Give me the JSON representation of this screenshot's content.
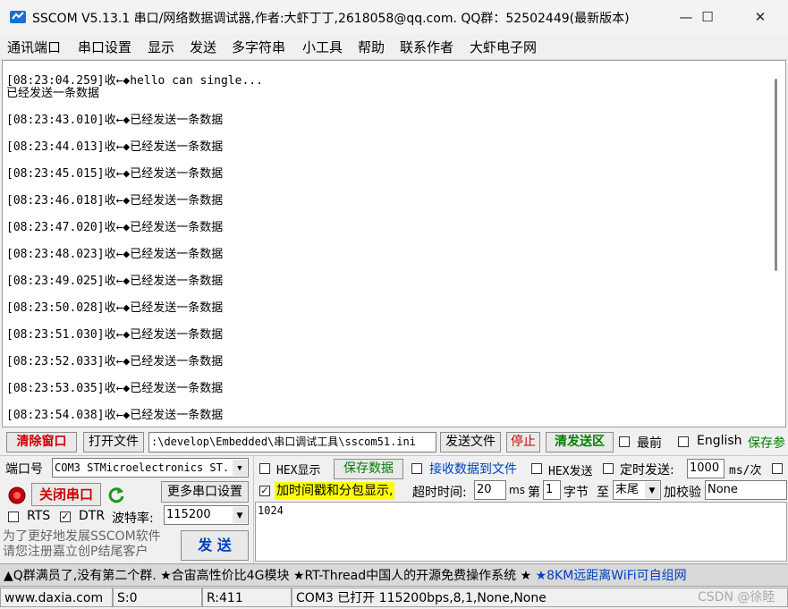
{
  "window": {
    "title": "SSCOM V5.13.1 串口/网络数据调试器,作者:大虾丁丁,2618058@qq.com. QQ群：52502449(最新版本)",
    "minimize": "—",
    "maximize": "☐",
    "close": "✕"
  },
  "menu": [
    "通讯端口",
    "串口设置",
    "显示",
    "发送",
    "多字符串",
    "小工具",
    "帮助",
    "联系作者",
    "大虾电子网"
  ],
  "receive": {
    "lines": [
      "[08:23:04.259]收←◆hello can single...",
      "已经发送一条数据",
      "[08:23:43.010]收←◆已经发送一条数据",
      "[08:23:44.013]收←◆已经发送一条数据",
      "[08:23:45.015]收←◆已经发送一条数据",
      "[08:23:46.018]收←◆已经发送一条数据",
      "[08:23:47.020]收←◆已经发送一条数据",
      "[08:23:48.023]收←◆已经发送一条数据",
      "[08:23:49.025]收←◆已经发送一条数据",
      "[08:23:50.028]收←◆已经发送一条数据",
      "[08:23:51.030]收←◆已经发送一条数据",
      "[08:23:52.033]收←◆已经发送一条数据",
      "[08:23:53.035]收←◆已经发送一条数据",
      "[08:23:54.038]收←◆已经发送一条数据"
    ]
  },
  "toolbar": {
    "clear_window": "清除窗口",
    "open_file": "打开文件",
    "file_path": ":\\develop\\Embedded\\串口调试工具\\sscom51.ini",
    "send_file": "发送文件",
    "stop": "停止",
    "clear_send": "清发送区",
    "topmost": "最前",
    "english": "English",
    "save_params": "保存参"
  },
  "port": {
    "port_label": "端口号",
    "port_value": "COM3 STMicroelectronics ST.",
    "close_port": "关闭串口",
    "more_settings": "更多串口设置",
    "rts": "RTS",
    "dtr": "DTR",
    "baud_label": "波特率:",
    "baud_value": "115200"
  },
  "options": {
    "hex_display": "HEX显示",
    "save_data": "保存数据",
    "receive_to_file": "接收数据到文件",
    "hex_send": "HEX发送",
    "timed_send": "定时发送:",
    "interval": "1000",
    "interval_unit": "ms/次",
    "timestamp": "加时间戳和分包显示,",
    "timeout_label": "超时时间:",
    "timeout_value": "20",
    "timeout_unit": "ms",
    "byte_prefix": "第",
    "byte_index": "1",
    "byte_suffix": "字节",
    "to_label": "至",
    "to_value": "末尾",
    "checksum_label": "加校验",
    "checksum_value": "None"
  },
  "send": {
    "text": "1024",
    "button": "发 送",
    "promo": "为了更好地发展SSCOM软件\n请您注册嘉立创P结尾客户"
  },
  "ticker": {
    "text1": "▲Q群满员了,没有第二个群. ★合宙高性价比4G模块 ★RT-Thread中国人的开源免费操作系统 ★",
    "text2": "★8KM远距离WiFi可自组网"
  },
  "status": {
    "site": "www.daxia.com",
    "sent": "S:0",
    "received": "R:411",
    "port_status": "COM3 已打开  115200bps,8,1,None,None",
    "watermark": "CSDN @徐睦"
  },
  "colors": {
    "accent_red": "#d00000",
    "accent_green": "#008000",
    "accent_blue": "#0040c0",
    "highlight_yellow": "#ffff00"
  }
}
